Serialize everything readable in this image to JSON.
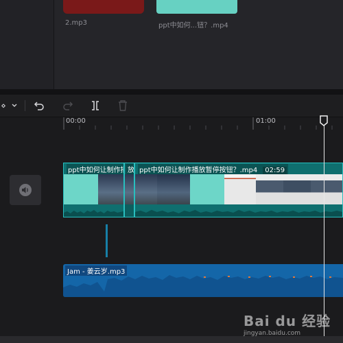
{
  "media": {
    "items": [
      {
        "name": "2.mp3",
        "color": "#7a1919"
      },
      {
        "name": "ppt中如何...钮？.mp4",
        "color": "#67d1c2"
      }
    ]
  },
  "toolbar": {
    "buttons": [
      {
        "icon": "cursor-select-icon",
        "glyph": "⋄"
      },
      {
        "icon": "chevron-down-icon",
        "glyph": "⌄"
      },
      {
        "icon": "undo-icon",
        "glyph": "↶"
      },
      {
        "icon": "redo-icon",
        "glyph": "↷",
        "disabled": true
      },
      {
        "icon": "split-icon",
        "glyph": "]["
      },
      {
        "icon": "delete-icon",
        "glyph": "🗑",
        "disabled": true
      }
    ]
  },
  "ruler": {
    "ticks": [
      "00:00",
      "01:00"
    ]
  },
  "video_track": {
    "clip1_title": "ppt中如何让制作播",
    "clip2_title": "放",
    "clip3_title": "ppt中如何让制作播放暂停按钮？.mp4",
    "clip3_duration": "02:59"
  },
  "audio_track": {
    "title": "Jam - 姜云岁.mp3"
  },
  "watermark": {
    "brand": "Bai du 经验",
    "url": "jingyan.baidu.com"
  },
  "colors": {
    "video_clip": "#0f6f6f",
    "audio_clip": "#1466a8",
    "accent": "#28bfbf"
  }
}
